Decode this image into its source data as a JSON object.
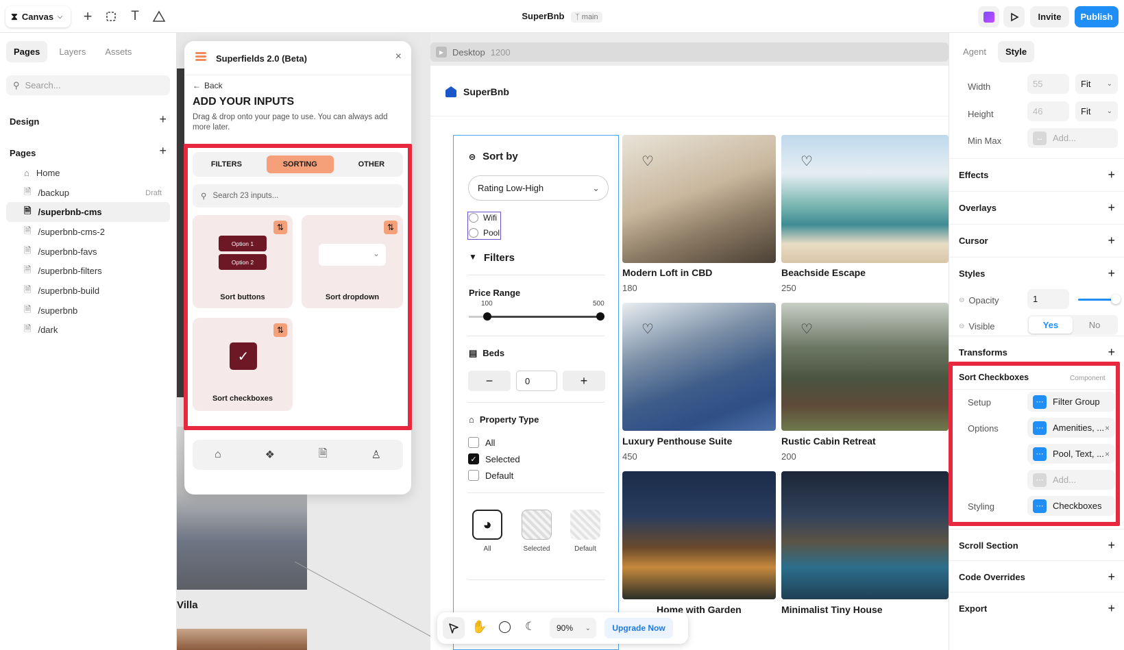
{
  "topbar": {
    "menu_label": "Canvas",
    "doc_title": "SuperBnb",
    "branch": "main",
    "invite": "Invite",
    "publish": "Publish"
  },
  "left": {
    "tabs": [
      "Pages",
      "Layers",
      "Assets"
    ],
    "search_placeholder": "Search...",
    "design_label": "Design",
    "pages_label": "Pages",
    "pages": [
      {
        "name": "Home",
        "icon": "home-icon"
      },
      {
        "name": "/backup",
        "badge": "Draft"
      },
      {
        "name": "/superbnb-cms"
      },
      {
        "name": "/superbnb-cms-2"
      },
      {
        "name": "/superbnb-favs"
      },
      {
        "name": "/superbnb-filters"
      },
      {
        "name": "/superbnb-build"
      },
      {
        "name": "/superbnb"
      },
      {
        "name": "/dark"
      }
    ]
  },
  "canvas_left": {
    "villa_label": "Villa"
  },
  "modal": {
    "title": "Superfields 2.0 (Beta)",
    "back": "Back",
    "heading": "ADD YOUR INPUTS",
    "subtitle": "Drag & drop onto your page to use. You can always add more later.",
    "tabs": [
      "FILTERS",
      "SORTING",
      "OTHER"
    ],
    "search_placeholder": "Search 23 inputs...",
    "cards": [
      {
        "label": "Sort buttons",
        "opt1": "Option 1",
        "opt2": "Option 2"
      },
      {
        "label": "Sort dropdown"
      },
      {
        "label": "Sort checkboxes"
      }
    ]
  },
  "frame": {
    "label": "Desktop",
    "width_value": "1200",
    "brand": "SuperBnb",
    "sort_by": "Sort by",
    "sort_value": "Rating Low-High",
    "wifi": "Wifi",
    "pool": "Pool",
    "filters": "Filters",
    "price_range": "Price Range",
    "price_min": "100",
    "price_max": "500",
    "beds": "Beds",
    "beds_value": "0",
    "property_type": "Property Type",
    "prop_options": [
      "All",
      "Selected",
      "Default"
    ],
    "tiles": [
      {
        "label": "All"
      },
      {
        "label": "Selected"
      },
      {
        "label": "Default"
      }
    ],
    "listings": [
      {
        "name": "Modern Loft in CBD",
        "price": "180"
      },
      {
        "name": "Beachside Escape",
        "price": "250"
      },
      {
        "name": "Luxury Penthouse Suite",
        "price": "450"
      },
      {
        "name": "Rustic Cabin Retreat",
        "price": "200"
      },
      {
        "name": "Home with Garden",
        "price": ""
      },
      {
        "name": "Minimalist Tiny House",
        "price": ""
      }
    ]
  },
  "bottom_toolbar": {
    "zoom": "90%",
    "upgrade": "Upgrade Now"
  },
  "right": {
    "tabs": [
      "Agent",
      "Style"
    ],
    "width_label": "Width",
    "width_value": "55",
    "width_mode": "Fit",
    "height_label": "Height",
    "height_value": "46",
    "height_mode": "Fit",
    "minmax_label": "Min Max",
    "minmax_value": "Add...",
    "sections1": [
      "Effects",
      "Overlays",
      "Cursor"
    ],
    "styles_label": "Styles",
    "opacity_label": "Opacity",
    "opacity_value": "1",
    "visible_label": "Visible",
    "visible_yes": "Yes",
    "visible_no": "No",
    "transforms_label": "Transforms",
    "component_title": "Sort Checkboxes",
    "component_tag": "Component",
    "setup_label": "Setup",
    "setup_value": "Filter Group",
    "options_label": "Options",
    "option1": "Amenities, ...",
    "option2": "Pool, Text, ...",
    "add_label": "Add...",
    "styling_label": "Styling",
    "styling_value": "Checkboxes",
    "sections2": [
      "Scroll Section",
      "Code Overrides",
      "Export"
    ]
  }
}
